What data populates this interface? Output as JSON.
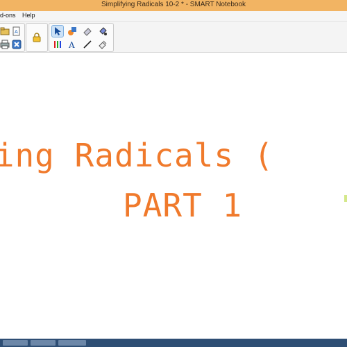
{
  "window": {
    "title": "Simplifying Radicals 10-2 * - SMART Notebook"
  },
  "menu": {
    "items": [
      "d-ons",
      "Help"
    ]
  },
  "toolbar": {
    "groups": [
      {
        "name": "file-tools",
        "buttons": [
          "open-icon",
          "page-icon",
          "print-icon",
          "delete-icon"
        ]
      },
      {
        "name": "lock-tool",
        "buttons": [
          "lock-icon"
        ]
      },
      {
        "name": "drawing-tools",
        "buttons": [
          "select-icon",
          "shapes-icon",
          "eraser-icon",
          "fill-icon",
          "pens-icon",
          "text-icon",
          "line-icon",
          "magic-eraser-icon"
        ]
      }
    ]
  },
  "canvas": {
    "line1": "lifying Radicals (",
    "line2": "PART 1",
    "text_color": "#f07a2c"
  },
  "colors": {
    "titlebar": "#f2b463",
    "taskbar": "#2e4e74"
  }
}
